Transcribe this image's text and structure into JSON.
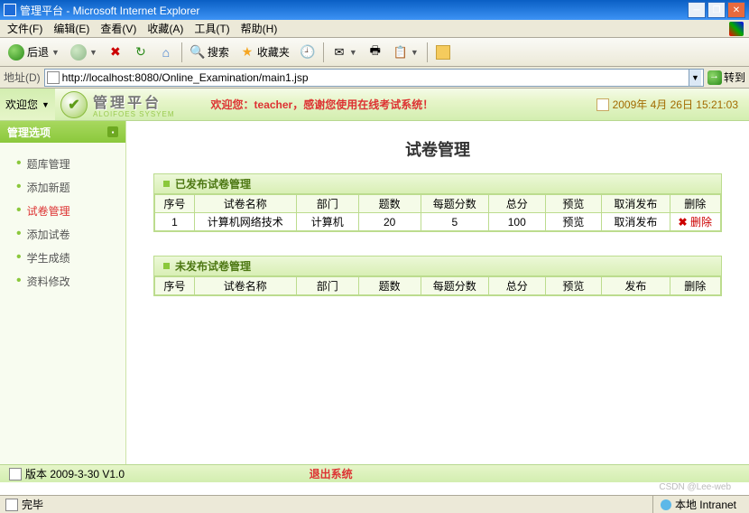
{
  "window": {
    "title": "管理平台 - Microsoft Internet Explorer"
  },
  "menu": {
    "items": [
      "文件(F)",
      "编辑(E)",
      "查看(V)",
      "收藏(A)",
      "工具(T)",
      "帮助(H)"
    ]
  },
  "toolbar": {
    "back": "后退",
    "search": "搜索",
    "fav": "收藏夹"
  },
  "addr": {
    "label": "地址(D)",
    "url": "http://localhost:8080/Online_Examination/main1.jsp",
    "go": "转到"
  },
  "header": {
    "welcome_user": "欢迎您",
    "brand": "管理平台",
    "brand_sub": "ALOIFOES SYSYEM",
    "msg_pre": "欢迎您：",
    "msg_user": "teacher",
    "msg_post": "，感谢您使用在线考试系统！",
    "datetime": "2009年 4月 26日 15:21:03"
  },
  "sidebar": {
    "title": "管理选项",
    "items": [
      "题库管理",
      "添加新题",
      "试卷管理",
      "添加试卷",
      "学生成绩",
      "资料修改"
    ],
    "active": 2
  },
  "main": {
    "title": "试卷管理",
    "pub_title": "已发布试卷管理",
    "unpub_title": "未发布试卷管理",
    "cols_pub": [
      "序号",
      "试卷名称",
      "部门",
      "题数",
      "每题分数",
      "总分",
      "预览",
      "取消发布",
      "删除"
    ],
    "cols_unpub": [
      "序号",
      "试卷名称",
      "部门",
      "题数",
      "每题分数",
      "总分",
      "预览",
      "发布",
      "删除"
    ],
    "rows_pub": [
      {
        "idx": "1",
        "name": "计算机网络技术",
        "dept": "计算机",
        "qn": "20",
        "per": "5",
        "total": "100",
        "preview": "预览",
        "cancel": "取消发布",
        "del": "删除"
      }
    ]
  },
  "footer": {
    "version": "版本 2009-3-30 V1.0",
    "logout": "退出系统"
  },
  "watermark": "CSDN @Lee-web",
  "status": {
    "done": "完毕",
    "zone": "本地 Intranet"
  }
}
